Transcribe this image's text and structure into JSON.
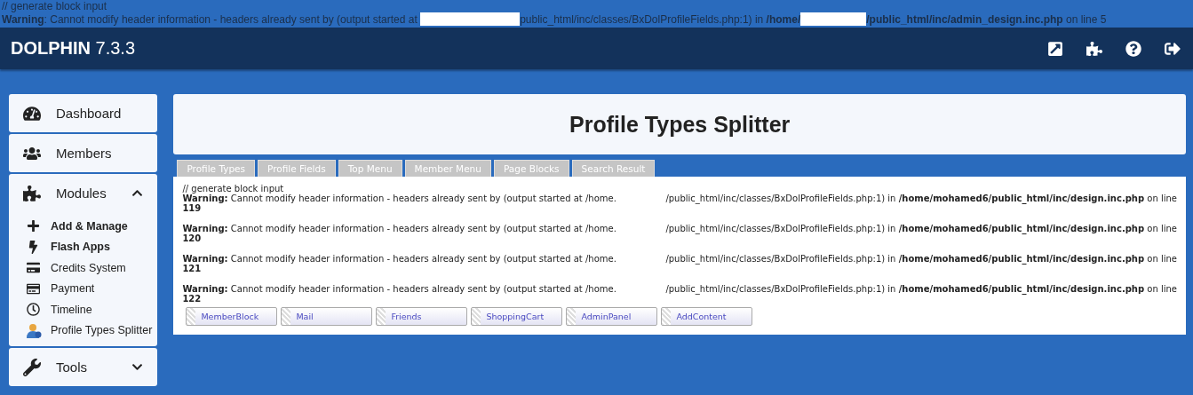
{
  "top_output": {
    "comment": "// generate block input",
    "warning": {
      "label": "Warning",
      "message": ": Cannot modify header information - headers already sent by (output started at ",
      "after_redaction": "public_html/inc/classes/BxDolProfileFields.php:1) in ",
      "path_start": "/home/",
      "path_end": "/public_html/inc/admin_design.inc.php",
      "tail": " on line 5"
    }
  },
  "header": {
    "brand": "DOLPHIN",
    "version": "7.3.3",
    "actions": [
      {
        "kind": "external"
      },
      {
        "kind": "modules"
      },
      {
        "kind": "help"
      },
      {
        "kind": "logout"
      }
    ]
  },
  "sidebar": {
    "items": [
      {
        "label": "Dashboard"
      },
      {
        "label": "Members"
      },
      {
        "label": "Modules",
        "expanded": true,
        "children": [
          {
            "label": "Add & Manage",
            "highlighted": true
          },
          {
            "label": "Flash Apps",
            "highlighted": true
          },
          {
            "label": "Credits System",
            "highlighted": false
          },
          {
            "label": "Payment",
            "highlighted": false
          },
          {
            "label": "Timeline",
            "highlighted": false
          },
          {
            "label": "Profile Types Splitter",
            "highlighted": false
          }
        ]
      },
      {
        "label": "Tools",
        "expanded": false
      }
    ]
  },
  "page": {
    "title": "Profile Types Splitter",
    "tabs": [
      {
        "label": "Profile Types",
        "selected": false
      },
      {
        "label": "Profile Fields",
        "selected": false
      },
      {
        "label": "Top Menu",
        "selected": false
      },
      {
        "label": "Member Menu",
        "selected": false
      },
      {
        "label": "Page Blocks",
        "selected": false
      },
      {
        "label": "Search Result",
        "selected": false
      }
    ],
    "comment": "// generate block input",
    "warnings": [
      {
        "start": "**Warning:** Cannot modify header information - headers already sent by (output started at /home.",
        "end": "/public_html/inc/classes/BxDolProfileFields.php:1) in **/home/mohamed6/public_html/inc/design.inc.php** on line",
        "line": "119"
      },
      {
        "start": "**Warning:** Cannot modify header information - headers already sent by (output started at /home.",
        "end": "/public_html/inc/classes/BxDolProfileFields.php:1) in **/home/mohamed6/public_html/inc/design.inc.php** on line",
        "line": "120"
      },
      {
        "start": "**Warning:** Cannot modify header information - headers already sent by (output started at /home.",
        "end": "/public_html/inc/classes/BxDolProfileFields.php:1) in **/home/mohamed6/public_html/inc/design.inc.php** on line",
        "line": "121"
      },
      {
        "start": "**Warning:** Cannot modify header information - headers already sent by (output started at /home.",
        "end": "/public_html/inc/classes/BxDolProfileFields.php:1) in **/home/mohamed6/public_html/inc/design.inc.php** on line",
        "line": "122"
      }
    ],
    "blocks": [
      "MemberBlock",
      "Mail",
      "Friends",
      "ShoppingCart",
      "AdminPanel",
      "AddContent"
    ]
  }
}
